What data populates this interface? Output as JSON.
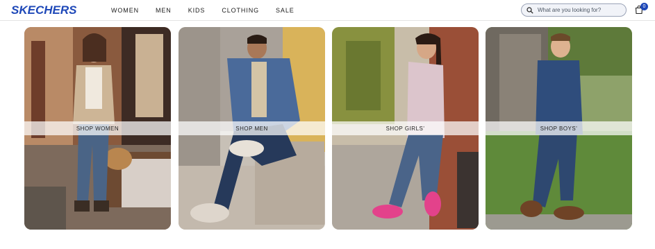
{
  "header": {
    "logo_text": "SKECHERS",
    "nav": [
      "WOMEN",
      "MEN",
      "KIDS",
      "CLOTHING",
      "SALE"
    ],
    "search_placeholder": "What are you looking for?",
    "cart_count": "0"
  },
  "tiles": [
    {
      "label": "SHOP WOMEN"
    },
    {
      "label": "SHOP MEN"
    },
    {
      "label": "SHOP GIRLS'"
    },
    {
      "label": "SHOP BOYS'"
    }
  ],
  "colors": {
    "brand": "#1e48b8",
    "text": "#1a1a1a"
  }
}
